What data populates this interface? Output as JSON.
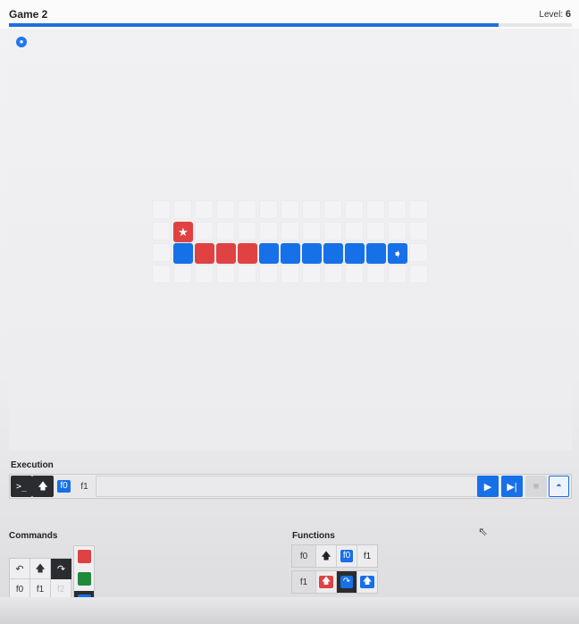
{
  "header": {
    "title": "Game 2",
    "level_label": "Level:",
    "level_value": "6",
    "progress": 0.87
  },
  "board": {
    "palette_icon": "palette-icon",
    "rows": 4,
    "cols": 13,
    "tiles": [
      {
        "row": 1,
        "col": 1,
        "color": "red",
        "icon": "star"
      },
      {
        "row": 2,
        "col": 1,
        "color": "blue"
      },
      {
        "row": 2,
        "col": 2,
        "color": "red"
      },
      {
        "row": 2,
        "col": 3,
        "color": "red"
      },
      {
        "row": 2,
        "col": 4,
        "color": "red"
      },
      {
        "row": 2,
        "col": 5,
        "color": "blue"
      },
      {
        "row": 2,
        "col": 6,
        "color": "blue"
      },
      {
        "row": 2,
        "col": 7,
        "color": "blue"
      },
      {
        "row": 2,
        "col": 8,
        "color": "blue"
      },
      {
        "row": 2,
        "col": 9,
        "color": "blue"
      },
      {
        "row": 2,
        "col": 10,
        "color": "blue"
      },
      {
        "row": 2,
        "col": 11,
        "color": "blue",
        "icon": "player"
      }
    ]
  },
  "execution": {
    "label": "Execution",
    "console_icon": "console-icon",
    "forward_icon": "arrow-up-icon",
    "f0_label": "f0",
    "f1_label": "f1",
    "controls": [
      "play-icon",
      "step-icon",
      "stop-icon",
      "speed-icon"
    ]
  },
  "commands": {
    "label": "Commands",
    "row1": [
      "turn-left-icon",
      "arrow-up-icon",
      "turn-right-icon"
    ],
    "row2": [
      "f0",
      "f1",
      "f2"
    ],
    "colors": [
      "#e04243",
      "#1f8a3a",
      "#1670e8"
    ]
  },
  "functions": {
    "label": "Functions",
    "f0": {
      "name": "f0",
      "slots": [
        "arrow-up-icon",
        "f0",
        "f1"
      ]
    },
    "f1": {
      "name": "f1",
      "slots": [
        "arrow-up-icon",
        "turn-right-icon",
        "arrow-up-icon"
      ]
    }
  },
  "colors": {
    "accent": "#1670e8",
    "red": "#e04243",
    "green": "#1f8a3a",
    "dark": "#2b2c30"
  }
}
